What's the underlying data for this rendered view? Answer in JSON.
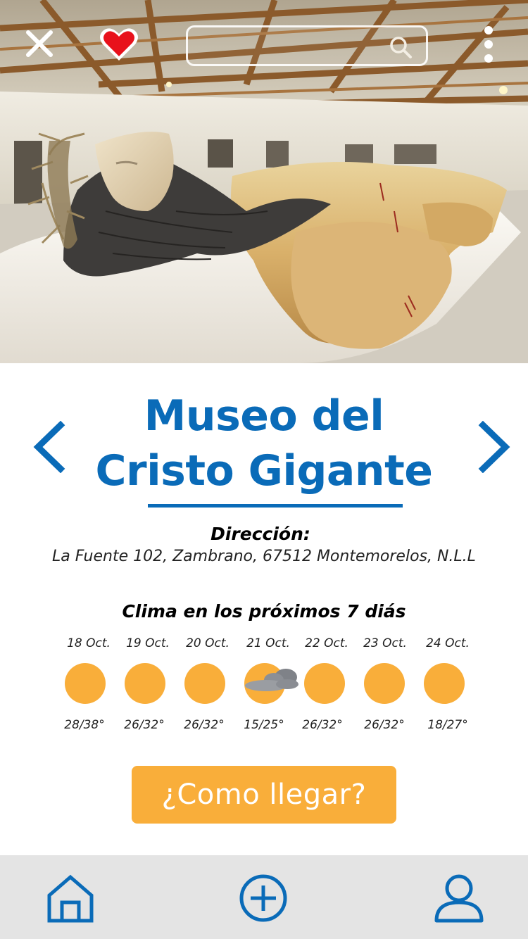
{
  "header": {
    "search_placeholder": "",
    "icons": [
      "close-icon",
      "heart-icon",
      "search-icon",
      "more-vertical-icon"
    ],
    "favorite_color": "#e8111b"
  },
  "place": {
    "title_line1": "Museo del",
    "title_line2": "Cristo Gigante",
    "address_label": "Dirección:",
    "address": "La Fuente 102, Zambrano, 67512 Montemorelos, N.L.L"
  },
  "weather": {
    "title": "Clima en los próximos 7 diás",
    "days": [
      {
        "date": "18 Oct.",
        "temp": "28/38°",
        "icon": "sun-icon"
      },
      {
        "date": "19 Oct.",
        "temp": "26/32°",
        "icon": "sun-icon"
      },
      {
        "date": "20 Oct.",
        "temp": "26/32°",
        "icon": "sun-icon"
      },
      {
        "date": "21 Oct.",
        "temp": "15/25°",
        "icon": "partly-cloudy-icon"
      },
      {
        "date": "22 Oct.",
        "temp": "26/32°",
        "icon": "sun-icon"
      },
      {
        "date": "23 Oct.",
        "temp": "26/32°",
        "icon": "sun-icon"
      },
      {
        "date": "24 Oct.",
        "temp": "18/27°",
        "icon": "sun-icon"
      }
    ]
  },
  "cta": {
    "label": "¿Como llegar?"
  },
  "bottom_nav": {
    "items": [
      "home-icon",
      "add-circle-icon",
      "profile-icon"
    ]
  },
  "colors": {
    "primary_blue": "#0a6bb8",
    "accent_orange": "#f9ae3a",
    "bottom_bar": "#e4e4e4"
  }
}
